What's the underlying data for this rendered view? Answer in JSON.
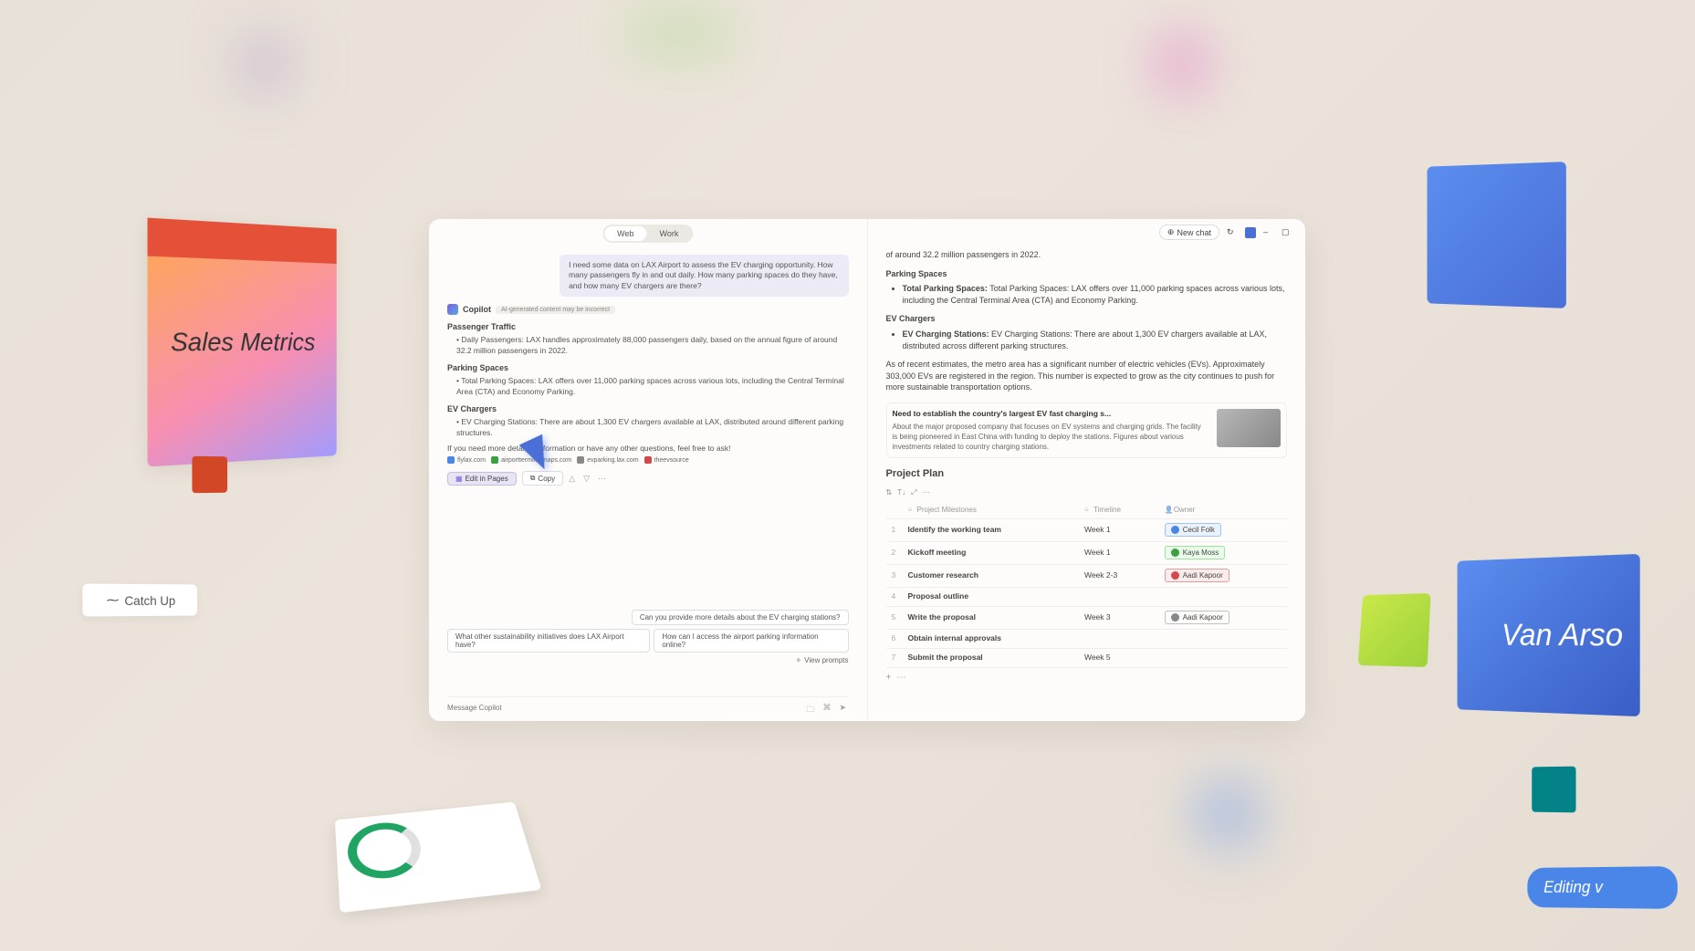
{
  "background": {
    "sales_metrics_label": "Sales Metrics",
    "catchup_label": "Catch Up",
    "van_arso_label": "Van Arso",
    "editing_label": "Editing v"
  },
  "header": {
    "tabs": [
      "Web",
      "Work"
    ],
    "activeTab": 0,
    "new_chat": "New chat"
  },
  "chat": {
    "user_message": "I need some data on LAX Airport to assess the EV charging opportunity. How many passengers fly in and out daily. How many parking spaces do they have, and how many EV chargers are there?",
    "copilot_label": "Copilot",
    "copilot_tag": "AI-generated content may be incorrect",
    "sections": {
      "passenger_h": "Passenger Traffic",
      "passenger_b": "Daily Passengers: LAX handles approximately 88,000 passengers daily, based on the annual figure of around 32.2 million passengers in 2022.",
      "parking_h": "Parking Spaces",
      "parking_b": "Total Parking Spaces: LAX offers over 11,000 parking spaces across various lots, including the Central Terminal Area (CTA) and Economy Parking.",
      "ev_h": "EV Chargers",
      "ev_b": "EV Charging Stations: There are about 1,300 EV chargers available at LAX, distributed around different parking structures.",
      "followup": "If you need more detailed information or have any other questions, feel free to ask!"
    },
    "references": {
      "ref1": "flylax.com",
      "ref2": "airportterminalmaps.com",
      "ref3": "evparking.lax.com",
      "ref4": "theevsource"
    },
    "actions": {
      "edit": "Edit in Pages",
      "copy": "Copy"
    },
    "suggestions": {
      "s1": "Can you provide more details about the EV charging stations?",
      "s2": "What other sustainability initiatives does LAX Airport have?",
      "s3": "How can I access the airport parking information online?",
      "view_prompts": "View prompts"
    },
    "input_placeholder": "Message Copilot"
  },
  "page": {
    "intro_line": "of around 32.2 million passengers in 2022.",
    "parking_h": "Parking Spaces",
    "parking_b": "Total Parking Spaces: LAX offers over 11,000 parking spaces across various lots, including the Central Terminal Area (CTA) and Economy Parking.",
    "ev_h": "EV Chargers",
    "ev_b": "EV Charging Stations: There are about 1,300 EV chargers available at LAX, distributed across different parking structures.",
    "context": "As of recent estimates, the metro area has a significant number of electric vehicles (EVs). Approximately 303,000 EVs are registered in the region. This number is expected to grow as the city continues to push for more sustainable transportation options.",
    "card": {
      "title": "Need to establish the country's largest EV fast charging s...",
      "body": "About the major proposed company that focuses on EV systems and charging grids. The facility is being pioneered in East China with funding to deploy the stations. Figures about various investments related to country charging stations."
    },
    "plan_title": "Project Plan",
    "table_headers": {
      "milestone": "Project Milestones",
      "timeline": "Timeline",
      "owner": "Owner"
    },
    "rows": [
      {
        "n": "1",
        "m": "Identify the working team",
        "t": "Week 1",
        "o": "Cecil Folk",
        "oc": "cecil"
      },
      {
        "n": "2",
        "m": "Kickoff meeting",
        "t": "Week 1",
        "o": "Kaya Moss",
        "oc": "kaya"
      },
      {
        "n": "3",
        "m": "Customer research",
        "t": "Week 2-3",
        "o": "Aadi Kapoor",
        "oc": "aadi"
      },
      {
        "n": "4",
        "m": "Proposal outline",
        "t": "",
        "o": "",
        "oc": ""
      },
      {
        "n": "5",
        "m": "Write the proposal",
        "t": "Week 3",
        "o": "Aadi Kapoor",
        "oc": "aadi2"
      },
      {
        "n": "6",
        "m": "Obtain internal approvals",
        "t": "",
        "o": "",
        "oc": ""
      },
      {
        "n": "7",
        "m": "Submit the proposal",
        "t": "Week 5",
        "o": "",
        "oc": ""
      }
    ]
  }
}
